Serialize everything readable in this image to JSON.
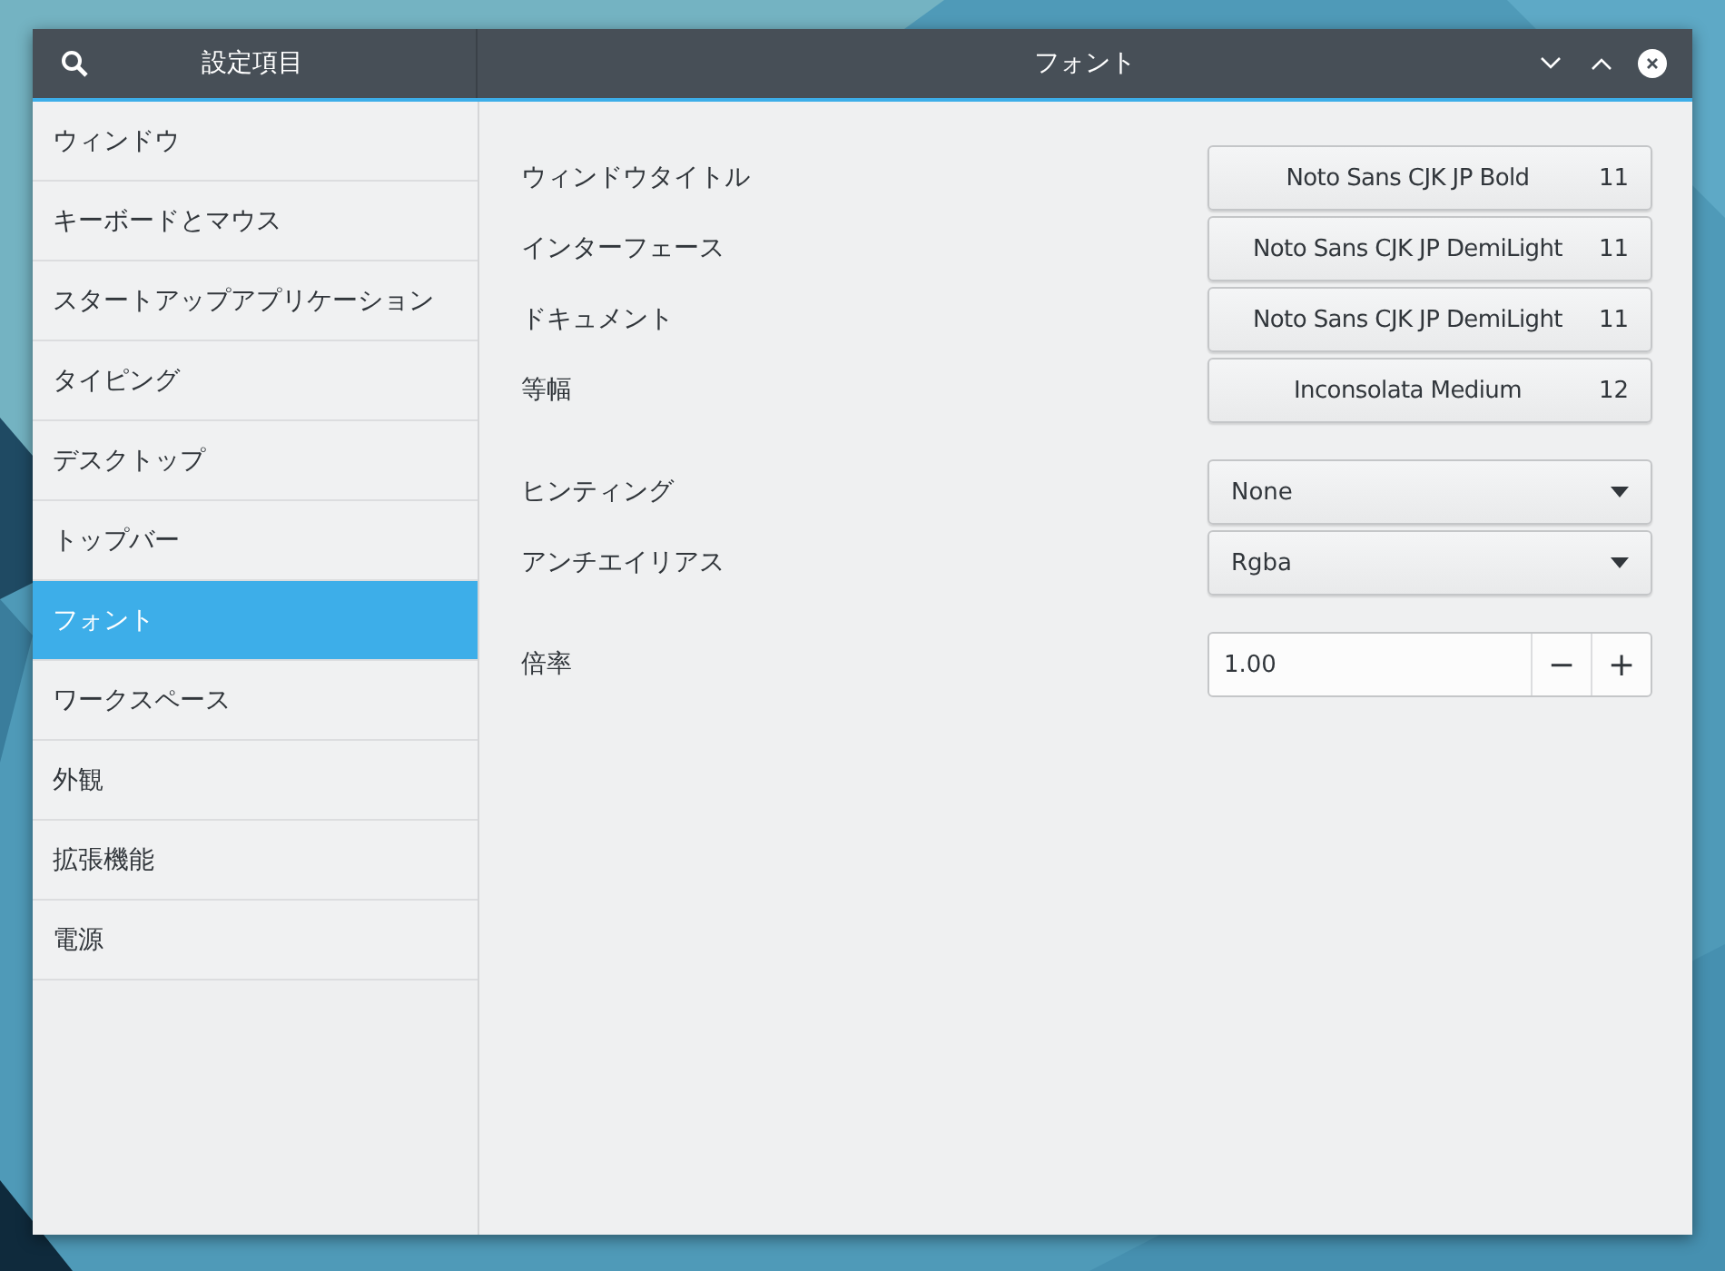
{
  "header": {
    "sidebar_title": "設定項目",
    "title": "フォント"
  },
  "sidebar": {
    "items": [
      {
        "label": "ウィンドウ",
        "selected": false
      },
      {
        "label": "キーボードとマウス",
        "selected": false
      },
      {
        "label": "スタートアップアプリケーション",
        "selected": false
      },
      {
        "label": "タイピング",
        "selected": false
      },
      {
        "label": "デスクトップ",
        "selected": false
      },
      {
        "label": "トップバー",
        "selected": false
      },
      {
        "label": "フォント",
        "selected": true
      },
      {
        "label": "ワークスペース",
        "selected": false
      },
      {
        "label": "外観",
        "selected": false
      },
      {
        "label": "拡張機能",
        "selected": false
      },
      {
        "label": "電源",
        "selected": false
      }
    ]
  },
  "groups": [
    {
      "rows": [
        {
          "kind": "font",
          "label": "ウィンドウタイトル",
          "font": "Noto Sans CJK JP Bold",
          "size": "11"
        },
        {
          "kind": "font",
          "label": "インターフェース",
          "font": "Noto Sans CJK JP DemiLight",
          "size": "11"
        },
        {
          "kind": "font",
          "label": "ドキュメント",
          "font": "Noto Sans CJK JP DemiLight",
          "size": "11"
        },
        {
          "kind": "font",
          "label": "等幅",
          "font": "Inconsolata Medium",
          "size": "12"
        }
      ]
    },
    {
      "rows": [
        {
          "kind": "combo",
          "label": "ヒンティング",
          "value": "None"
        },
        {
          "kind": "combo",
          "label": "アンチエイリアス",
          "value": "Rgba"
        }
      ]
    },
    {
      "rows": [
        {
          "kind": "spin",
          "label": "倍率",
          "value": "1.00",
          "minus": "−",
          "plus": "+"
        }
      ]
    }
  ]
}
